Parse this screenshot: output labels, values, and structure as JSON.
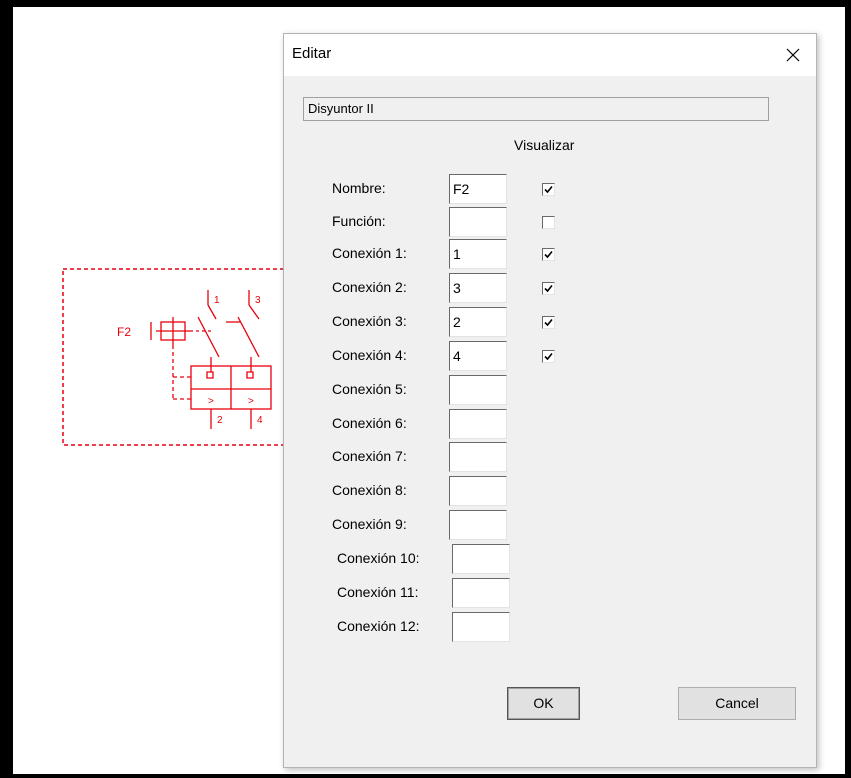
{
  "schematic": {
    "tag": "F2",
    "terminals_top": [
      "1",
      "3"
    ],
    "terminals_bottom": [
      "2",
      "4"
    ],
    "thermal_symbol": ">",
    "color": "#e8000b"
  },
  "dialog": {
    "title": "Editar",
    "close_icon": "close-icon",
    "component_name": "Disyuntor II",
    "visualize_header": "Visualizar",
    "fields": [
      {
        "label": "Nombre:",
        "value": "F2",
        "visible": true
      },
      {
        "label": "Función:",
        "value": "",
        "visible": false
      },
      {
        "label": "Conexión 1:",
        "value": "1",
        "visible": true
      },
      {
        "label": "Conexión 2:",
        "value": "3",
        "visible": true
      },
      {
        "label": "Conexión 3:",
        "value": "2",
        "visible": true
      },
      {
        "label": "Conexión 4:",
        "value": "4",
        "visible": true
      },
      {
        "label": "Conexión 5:",
        "value": ""
      },
      {
        "label": "Conexión 6:",
        "value": ""
      },
      {
        "label": "Conexión 7:",
        "value": ""
      },
      {
        "label": "Conexión 8:",
        "value": ""
      },
      {
        "label": "Conexión 9:",
        "value": ""
      },
      {
        "label": "Conexión 10:",
        "value": ""
      },
      {
        "label": "Conexión 11:",
        "value": ""
      },
      {
        "label": "Conexión 12:",
        "value": ""
      }
    ],
    "ok_label": "OK",
    "cancel_label": "Cancel"
  }
}
